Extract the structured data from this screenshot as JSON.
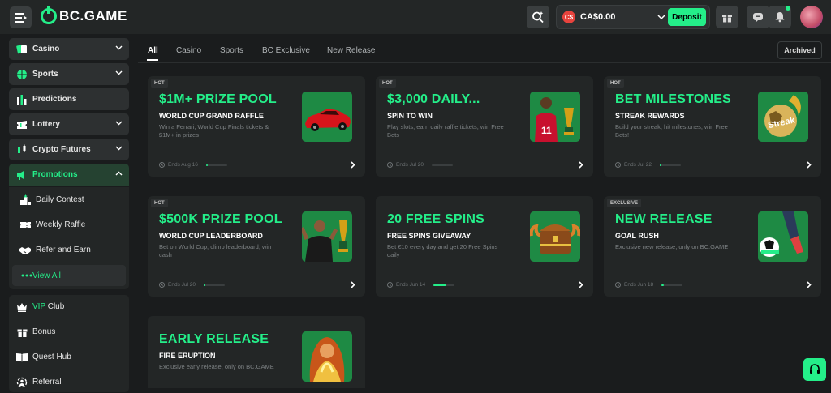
{
  "header": {
    "logo_text": "BC.GAME",
    "currency_symbol": "C$",
    "balance": "CA$0.00",
    "deposit_label": "Deposit",
    "accent": "#24ee89"
  },
  "sidebar": {
    "items": [
      {
        "label": "Casino",
        "icon": "casino-cards-icon"
      },
      {
        "label": "Sports",
        "icon": "basketball-icon"
      },
      {
        "label": "Predictions",
        "icon": "predictions-bars-icon"
      },
      {
        "label": "Lottery",
        "icon": "lottery-ticket-icon"
      },
      {
        "label": "Crypto Futures",
        "icon": "candlestick-icon"
      },
      {
        "label": "Promotions",
        "icon": "megaphone-icon"
      }
    ],
    "promotions_sub": [
      {
        "label": "Daily Contest",
        "icon": "podium-icon"
      },
      {
        "label": "Weekly Raffle",
        "icon": "ticket-icon"
      },
      {
        "label": "Refer and Earn",
        "icon": "handshake-icon"
      },
      {
        "label": "View All",
        "icon": "dots-icon"
      }
    ],
    "lower": [
      {
        "label_prefix": "VIP",
        "label_rest": " Club",
        "icon": "crown-icon"
      },
      {
        "label": "Bonus",
        "icon": "gift-icon"
      },
      {
        "label": "Quest Hub",
        "icon": "book-icon"
      },
      {
        "label": "Referral",
        "icon": "referral-icon"
      }
    ]
  },
  "tabs": [
    "All",
    "Casino",
    "Sports",
    "BC Exclusive",
    "New Release"
  ],
  "archived_label": "Archived",
  "cards": [
    {
      "badge": "HOT",
      "title": "$1M+ PRIZE POOL",
      "subtitle": "WORLD CUP GRAND RAFFLE",
      "desc": "Win a Ferrari, World Cup Finals tickets & $1M+ in prizes",
      "ends": "Ends Aug 16",
      "progress": 0.1
    },
    {
      "badge": "HOT",
      "title": "$3,000 DAILY...",
      "subtitle": "SPIN TO WIN",
      "desc": "Play slots, earn daily raffle tickets, win Free Bets",
      "ends": "Ends Jul 20",
      "progress": 0.0
    },
    {
      "badge": "HOT",
      "title": "BET MILESTONES",
      "subtitle": "STREAK REWARDS",
      "desc": "Build your streak, hit milestones, win Free Bets!",
      "ends": "Ends Jul 22",
      "progress": 0.05
    },
    {
      "badge": "HOT",
      "title": "$500K PRIZE POOL",
      "subtitle": "WORLD CUP LEADERBOARD",
      "desc": "Bet on World Cup, climb leaderboard, win cash",
      "ends": "Ends Jul 20",
      "progress": 0.05
    },
    {
      "badge": "",
      "title": "20 FREE SPINS",
      "subtitle": "FREE SPINS GIVEAWAY",
      "desc": "Bet €10 every day and get 20 Free Spins daily",
      "ends": "Ends Jun 14",
      "progress": 0.6
    },
    {
      "badge": "EXCLUSIVE",
      "title": "NEW RELEASE",
      "subtitle": "GOAL RUSH",
      "desc": "Exclusive new release, only on BC.GAME",
      "ends": "Ends Jun 18",
      "progress": 0.1
    },
    {
      "badge": "",
      "title": "EARLY RELEASE",
      "subtitle": "FIRE ERUPTION",
      "desc": "Exclusive early release, only on BC.GAME",
      "ends": "",
      "progress": 0
    }
  ]
}
